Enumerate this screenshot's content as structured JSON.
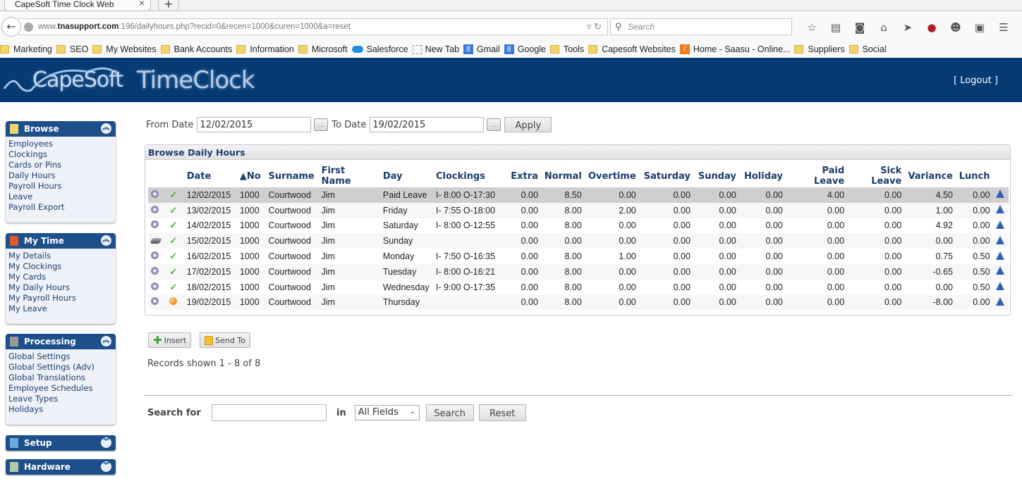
{
  "browser": {
    "tab_title": "CapeSoft Time Clock Web",
    "tab_close": "×",
    "new_tab": "+",
    "url_domain_prefix": "www.",
    "url_domain": "tnasupport.com",
    "url_rest": ":196/dailyhours.php?recid=0&recen=1000&curen=1000&a=reset",
    "search_placeholder": "Search",
    "bookmarks": [
      {
        "label": "Marketing",
        "icon": "folder"
      },
      {
        "label": "SEO",
        "icon": "folder"
      },
      {
        "label": "My Websites",
        "icon": "folder"
      },
      {
        "label": "Bank Accounts",
        "icon": "folder"
      },
      {
        "label": "Information",
        "icon": "folder"
      },
      {
        "label": "Microsoft",
        "icon": "folder"
      },
      {
        "label": "Salesforce",
        "icon": "salesforce-cloud"
      },
      {
        "label": "New Tab",
        "icon": "blank-page"
      },
      {
        "label": "Gmail",
        "icon": "google-8"
      },
      {
        "label": "Google",
        "icon": "google-8"
      },
      {
        "label": "Tools",
        "icon": "folder"
      },
      {
        "label": "Capesoft Websites",
        "icon": "folder"
      },
      {
        "label": "Home - Saasu - Online...",
        "icon": "saasu"
      },
      {
        "label": "Suppliers",
        "icon": "folder"
      },
      {
        "label": "Social",
        "icon": "folder"
      }
    ]
  },
  "app": {
    "logo_text_1": "CapeSoft",
    "logo_text_2": "TimeClock",
    "logout": "[ Logout ]",
    "brand_color": "#053a72"
  },
  "sidebar": {
    "panels": [
      {
        "title": "Browse",
        "expanded": true,
        "items": [
          "Employees",
          "Clockings",
          "Cards or Pins",
          "Daily Hours",
          "Payroll Hours",
          "Leave",
          "Payroll Export"
        ]
      },
      {
        "title": "My Time",
        "expanded": true,
        "items": [
          "My Details",
          "My Clockings",
          "My Cards",
          "My Daily Hours",
          "My Payroll Hours",
          "My Leave"
        ]
      },
      {
        "title": "Processing",
        "expanded": true,
        "items": [
          "Global Settings",
          "Global Settings (Adv)",
          "Global Translations",
          "Employee Schedules",
          "Leave Types",
          "Holidays"
        ]
      },
      {
        "title": "Setup",
        "expanded": false,
        "items": []
      },
      {
        "title": "Hardware",
        "expanded": false,
        "items": []
      }
    ]
  },
  "filter": {
    "from_label": "From Date",
    "from_value": "12/02/2015",
    "to_label": "To Date",
    "to_value": "19/02/2015",
    "picker_label": "...",
    "apply_label": "Apply"
  },
  "grid": {
    "title": "Browse Daily Hours",
    "columns": [
      "",
      "",
      "Date",
      "▲No",
      "Surname",
      "First Name",
      "Day",
      "Clockings",
      "Extra",
      "Normal",
      "Overtime",
      "Saturday",
      "Sunday",
      "Holiday",
      "Paid Leave",
      "Sick Leave",
      "Variance",
      "Lunch",
      ""
    ],
    "rows": [
      {
        "icon": "disc",
        "status": "check",
        "date": "12/02/2015",
        "no": "1000",
        "surname": "Courtwood",
        "first": "Jim",
        "day": "Paid Leave",
        "clockings": "I- 8:00 O-17:30",
        "extra": "0.00",
        "normal": "8.50",
        "overtime": "0.00",
        "saturday": "0.00",
        "sunday": "0.00",
        "holiday": "0.00",
        "paid": "4.00",
        "sick": "0.00",
        "variance": "4.50",
        "lunch": "0.00",
        "selected": true
      },
      {
        "icon": "disc",
        "status": "check",
        "date": "13/02/2015",
        "no": "1000",
        "surname": "Courtwood",
        "first": "Jim",
        "day": "Friday",
        "clockings": "I- 7:55 O-18:00",
        "extra": "0.00",
        "normal": "8.00",
        "overtime": "2.00",
        "saturday": "0.00",
        "sunday": "0.00",
        "holiday": "0.00",
        "paid": "0.00",
        "sick": "0.00",
        "variance": "1.00",
        "lunch": "0.00"
      },
      {
        "icon": "disc",
        "status": "check",
        "date": "14/02/2015",
        "no": "1000",
        "surname": "Courtwood",
        "first": "Jim",
        "day": "Saturday",
        "clockings": "I- 8:00 O-12:55",
        "extra": "0.00",
        "normal": "8.00",
        "overtime": "0.00",
        "saturday": "0.00",
        "sunday": "0.00",
        "holiday": "0.00",
        "paid": "0.00",
        "sick": "0.00",
        "variance": "4.92",
        "lunch": "0.00"
      },
      {
        "icon": "rubber",
        "status": "check",
        "date": "15/02/2015",
        "no": "1000",
        "surname": "Courtwood",
        "first": "Jim",
        "day": "Sunday",
        "clockings": "",
        "extra": "0.00",
        "normal": "0.00",
        "overtime": "0.00",
        "saturday": "0.00",
        "sunday": "0.00",
        "holiday": "0.00",
        "paid": "0.00",
        "sick": "0.00",
        "variance": "0.00",
        "lunch": "0.00"
      },
      {
        "icon": "disc",
        "status": "check",
        "date": "16/02/2015",
        "no": "1000",
        "surname": "Courtwood",
        "first": "Jim",
        "day": "Monday",
        "clockings": "I- 7:50 O-16:35",
        "extra": "0.00",
        "normal": "8.00",
        "overtime": "1.00",
        "saturday": "0.00",
        "sunday": "0.00",
        "holiday": "0.00",
        "paid": "0.00",
        "sick": "0.00",
        "variance": "0.75",
        "lunch": "0.50"
      },
      {
        "icon": "disc",
        "status": "check",
        "date": "17/02/2015",
        "no": "1000",
        "surname": "Courtwood",
        "first": "Jim",
        "day": "Tuesday",
        "clockings": "I- 8:00 O-16:21",
        "extra": "0.00",
        "normal": "8.00",
        "overtime": "0.00",
        "saturday": "0.00",
        "sunday": "0.00",
        "holiday": "0.00",
        "paid": "0.00",
        "sick": "0.00",
        "variance": "-0.65",
        "lunch": "0.50"
      },
      {
        "icon": "disc",
        "status": "check",
        "date": "18/02/2015",
        "no": "1000",
        "surname": "Courtwood",
        "first": "Jim",
        "day": "Wednesday",
        "clockings": "I- 9:00 O-17:35",
        "extra": "0.00",
        "normal": "8.00",
        "overtime": "0.00",
        "saturday": "0.00",
        "sunday": "0.00",
        "holiday": "0.00",
        "paid": "0.00",
        "sick": "0.00",
        "variance": "0.00",
        "lunch": "0.50"
      },
      {
        "icon": "disc",
        "status": "pending",
        "date": "19/02/2015",
        "no": "1000",
        "surname": "Courtwood",
        "first": "Jim",
        "day": "Thursday",
        "clockings": "",
        "extra": "0.00",
        "normal": "8.00",
        "overtime": "0.00",
        "saturday": "0.00",
        "sunday": "0.00",
        "holiday": "0.00",
        "paid": "0.00",
        "sick": "0.00",
        "variance": "-8.00",
        "lunch": "0.00"
      }
    ]
  },
  "actions": {
    "insert_label": "Insert",
    "sendto_label": "Send To"
  },
  "records_text": "Records shown 1 - 8 of 8",
  "search": {
    "label": "Search for",
    "value": "",
    "in_label": "in",
    "field_selected": "All Fields",
    "search_label": "Search",
    "reset_label": "Reset"
  }
}
